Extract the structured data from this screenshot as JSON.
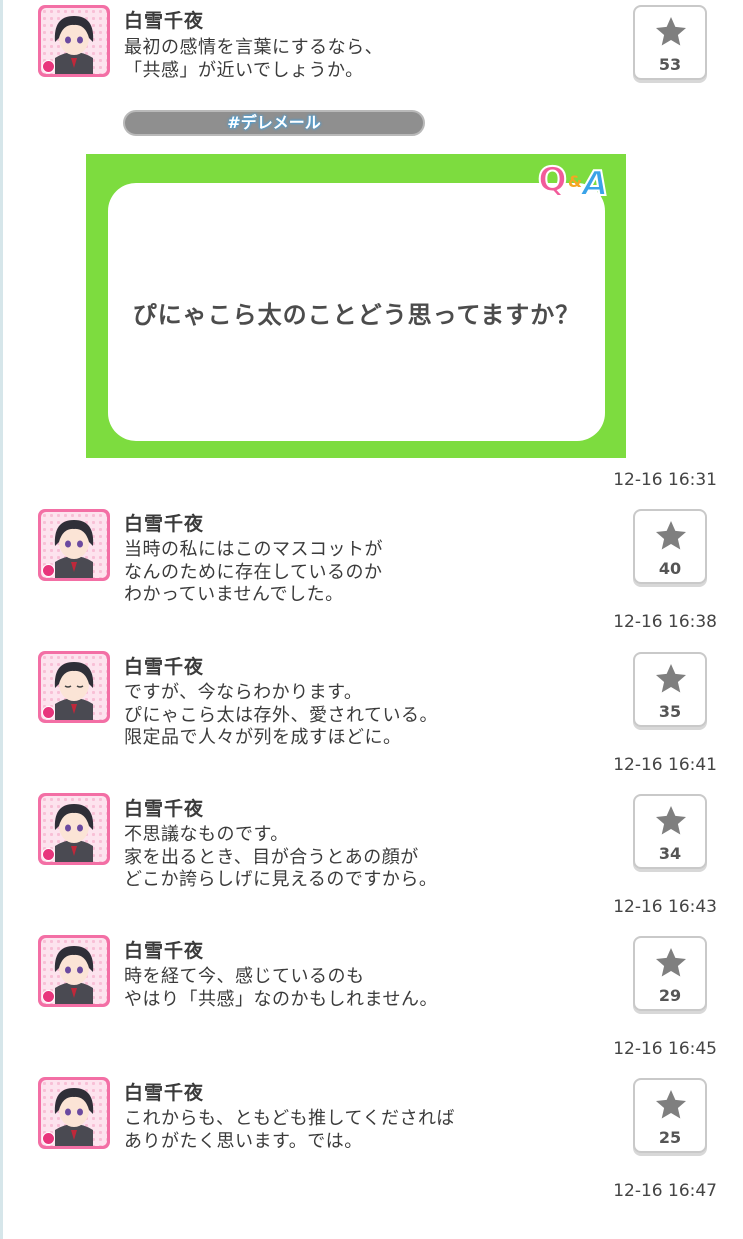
{
  "posts": [
    {
      "name": "白雪千夜",
      "message": "最初の感情を言葉にするなら、\n「共感」が近いでしょうか。",
      "likes": "53",
      "time": ""
    },
    {
      "name": "白雪千夜",
      "message": "当時の私にはこのマスコットが\nなんのために存在しているのか\nわかっていませんでした。",
      "likes": "40",
      "time": "12-16 16:38"
    },
    {
      "name": "白雪千夜",
      "message": "ですが、今ならわかります。\nぴにゃこら太は存外、愛されている。\n限定品で人々が列を成すほどに。",
      "likes": "35",
      "time": "12-16 16:41"
    },
    {
      "name": "白雪千夜",
      "message": "不思議なものです。\n家を出るとき、目が合うとあの顔が\nどこか誇らしげに見えるのですから。",
      "likes": "34",
      "time": "12-16 16:43"
    },
    {
      "name": "白雪千夜",
      "message": "時を経て今、感じているのも\nやはり「共感」なのかもしれません。",
      "likes": "29",
      "time": "12-16 16:45"
    },
    {
      "name": "白雪千夜",
      "message": "これからも、ともども推してくだされば\nありがたく思います。では。",
      "likes": "25",
      "time": "12-16 16:47"
    }
  ],
  "qa": {
    "hashtag": "#デレメール",
    "logo_q": "Q",
    "logo_amp": "&",
    "logo_a": "A",
    "question": "ぴにゃこら太のことどう思ってますか？",
    "time": "12-16 16:31"
  },
  "colors": {
    "qa_green": "#7ddc3f",
    "avatar_pink": "#f36fa5",
    "star_gray": "#7f7f7f"
  },
  "icons": {
    "like": "star-icon",
    "avatar": "character-avatar"
  }
}
